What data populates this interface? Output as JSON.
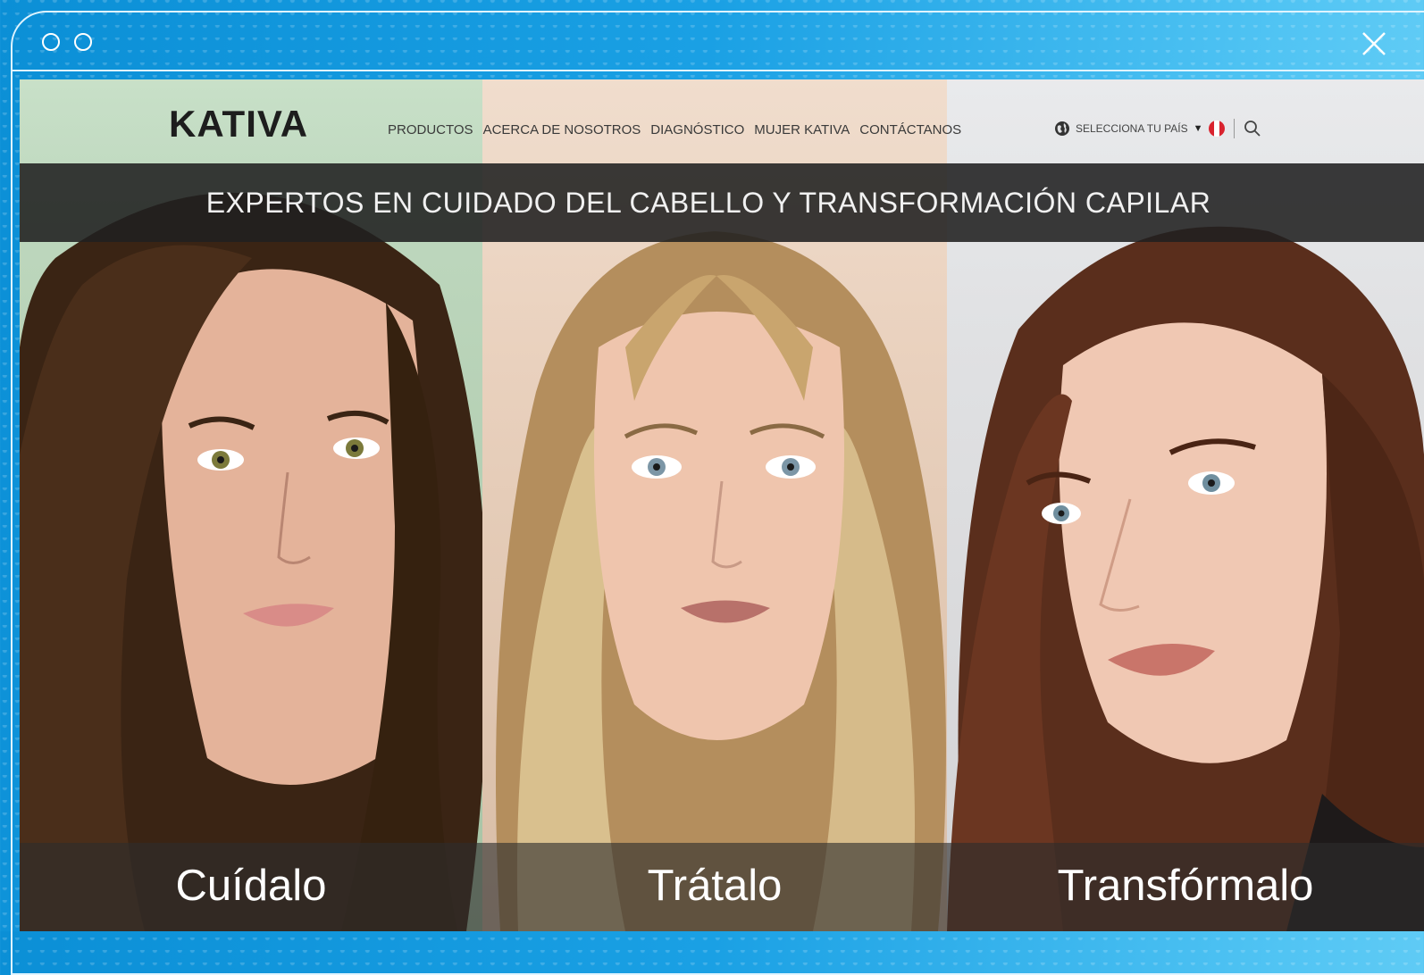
{
  "window": {
    "controls": [
      "circle-icon",
      "circle-icon"
    ],
    "close_icon": "close-icon"
  },
  "site": {
    "logo": "KATIVA",
    "menu": [
      {
        "label": "PRODUCTOS"
      },
      {
        "label": "ACERCA DE NOSOTROS"
      },
      {
        "label": "DIAGNÓSTICO"
      },
      {
        "label": "MUJER KATIVA"
      },
      {
        "label": "CONTÁCTANOS"
      }
    ],
    "country_selector": {
      "label": "SELECCIONA TU PAÍS",
      "arrow": "▼",
      "icon": "globe-icon",
      "flag": "peru-flag-icon"
    },
    "search_icon": "search-icon",
    "tagline": "EXPERTOS EN CUIDADO DEL CABELLO Y TRANSFORMACIÓN CAPILAR"
  },
  "panels": [
    {
      "caption": "Cuídalo"
    },
    {
      "caption": "Trátalo"
    },
    {
      "caption": "Transfórmalo"
    }
  ],
  "colors": {
    "flag_red": "#d9232e",
    "flag_white": "#ffffff",
    "frame_blue": "#1aa0e4"
  }
}
